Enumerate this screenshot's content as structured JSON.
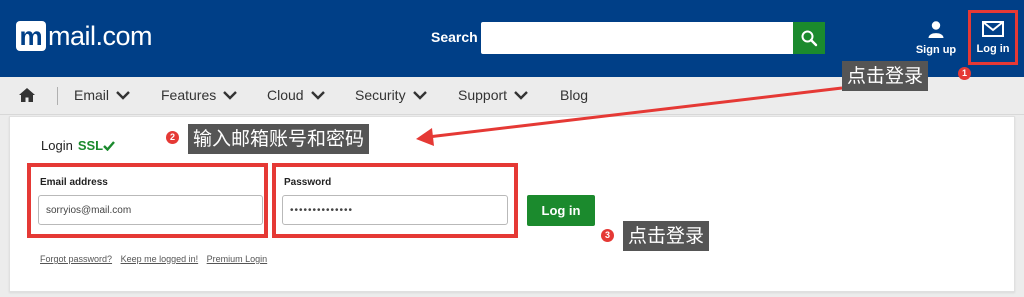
{
  "header": {
    "logo_text": "mail.com",
    "search_label": "Search",
    "search_value": "",
    "sign_up_label": "Sign up",
    "log_in_label": "Log in"
  },
  "nav": {
    "items": [
      {
        "label": "Email",
        "has_dropdown": true
      },
      {
        "label": "Features",
        "has_dropdown": true
      },
      {
        "label": "Cloud",
        "has_dropdown": true
      },
      {
        "label": "Security",
        "has_dropdown": true
      },
      {
        "label": "Support",
        "has_dropdown": true
      },
      {
        "label": "Blog",
        "has_dropdown": false
      }
    ]
  },
  "login": {
    "title": "Login",
    "ssl_label": "SSL",
    "email_label": "Email address",
    "email_value": "sorryios@mail.com",
    "password_label": "Password",
    "password_value": "••••••••••••••",
    "button_label": "Log in",
    "links": [
      "Forgot password?",
      "Keep me logged in!",
      "Premium Login"
    ]
  },
  "annotations": [
    {
      "number": "1",
      "text": "点击登录"
    },
    {
      "number": "2",
      "text": "输入邮箱账号和密码"
    },
    {
      "number": "3",
      "text": "点击登录"
    }
  ],
  "colors": {
    "header_bg": "#003f87",
    "brand_green": "#1b8a2d",
    "highlight_red": "#e53935"
  }
}
